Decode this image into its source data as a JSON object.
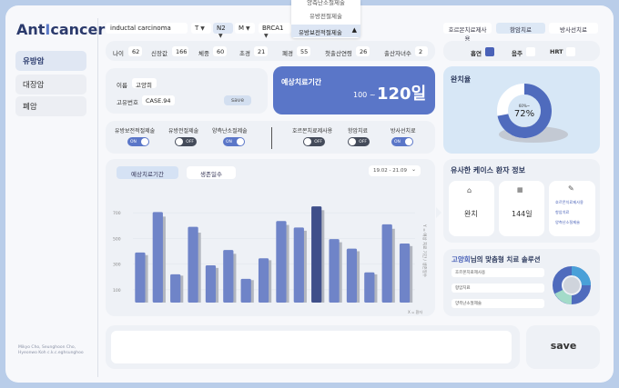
{
  "app": {
    "logo_a": "Ant",
    "logo_b": "I",
    "logo_c": "cancer",
    "credits": "Mikyo Cho, Seunghoon Cho, Hyeonwo Koh c.k.c.eghsunghoo"
  },
  "nav": {
    "items": [
      {
        "label": "유방암"
      },
      {
        "label": "대장암"
      },
      {
        "label": "폐암"
      }
    ]
  },
  "diagnosis": {
    "value": "inductal carcinoma",
    "t": "T",
    "n": "N2",
    "m": "M",
    "gene": "BRCA1"
  },
  "dropdown": {
    "options": [
      "양측난소절제술",
      "유방전절제술",
      "유방보전적절제술"
    ]
  },
  "top_tabs": [
    "호르몬치료제사용",
    "항암치료",
    "방사선치료"
  ],
  "vitals": [
    {
      "label": "나이",
      "value": "62"
    },
    {
      "label": "신장값",
      "value": "166"
    },
    {
      "label": "체중",
      "value": "60"
    },
    {
      "label": "초경",
      "value": "21"
    },
    {
      "label": "폐경",
      "value": "55"
    },
    {
      "label": "첫출산연령",
      "value": "26"
    },
    {
      "label": "출산자녀수",
      "value": "2"
    }
  ],
  "habits": [
    {
      "label": "흡연",
      "on": true
    },
    {
      "label": "음주",
      "on": false
    },
    {
      "label": "HRT",
      "on": false
    }
  ],
  "patient": {
    "name_label": "이름",
    "name": "고양희",
    "id_label": "고유번호",
    "id": "CASE.94",
    "save": "save"
  },
  "period": {
    "title": "예상치료기간",
    "prefix": "100 ~",
    "value": "120일"
  },
  "cure": {
    "title": "완치율",
    "center_small": "60%~",
    "center": "72%"
  },
  "treatments_left": [
    {
      "label": "유방보전적절제술",
      "state": "ON"
    },
    {
      "label": "유방전절제술",
      "state": "OFF"
    },
    {
      "label": "양측난소절제술",
      "state": "ON"
    }
  ],
  "treatments_right": [
    {
      "label": "호르몬치료제사용",
      "state": "OFF"
    },
    {
      "label": "항암치료",
      "state": "OFF"
    },
    {
      "label": "방사선치료",
      "state": "ON"
    }
  ],
  "chart_tabs": {
    "a": "예상치료기간",
    "b": "생존일수",
    "date": "19.02 - 21.09"
  },
  "chart_data": {
    "type": "bar",
    "yticks": [
      "700",
      "500",
      "300",
      "100"
    ],
    "ylim": [
      0,
      800
    ],
    "side_label": "Y = 예상 치료 기간 / 생존일수",
    "x_label": "X = 환자",
    "series": [
      {
        "values": [
          390,
          705,
          220,
          590,
          290,
          410,
          185,
          345,
          635,
          585,
          750,
          495,
          420,
          235,
          610,
          460
        ]
      },
      {
        "values": [
          370,
          670,
          210,
          545,
          270,
          380,
          175,
          330,
          605,
          560,
          720,
          470,
          400,
          220,
          575,
          440
        ]
      }
    ],
    "highlight_index": 10
  },
  "similar": {
    "title": "유사한 케이스 환자 정보",
    "result": "완치",
    "days": "144일",
    "list": [
      "호르몬치료제사용",
      "항암치료",
      "양측난소절제술"
    ]
  },
  "solution": {
    "name": "고양희",
    "title_suffix": "님의 맞춤형 치료 솔루션",
    "items": [
      "호르몬치료제사용",
      "항암치료",
      "양측난소절제술"
    ]
  },
  "note": {
    "placeholder": ""
  },
  "save_big": "save",
  "colors": {
    "accent": "#5a76c8",
    "dark": "#3f4f8a",
    "panel": "#d7e7f6"
  }
}
